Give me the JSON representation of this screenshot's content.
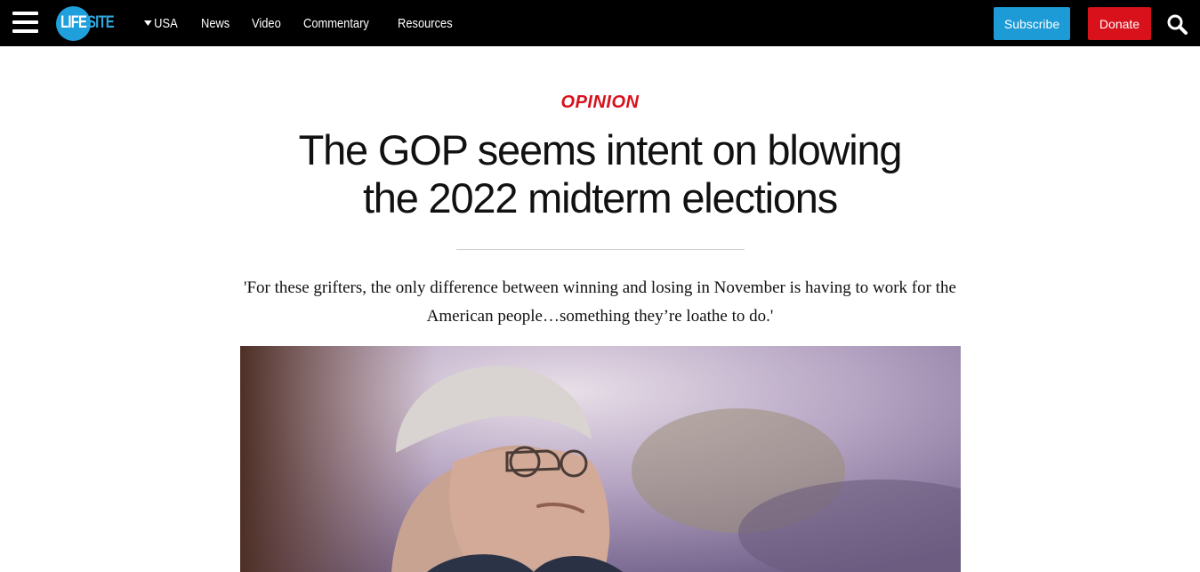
{
  "header": {
    "logo_text_1": "LIFE",
    "logo_text_2": "SITE",
    "menu_icon": "hamburger-menu-icon",
    "nav": [
      {
        "label": "USA",
        "icon": "caret-down-icon"
      },
      {
        "label": "News"
      },
      {
        "label": "Video"
      },
      {
        "label": "Commentary"
      },
      {
        "label": "Resources"
      }
    ],
    "subscribe_label": "Subscribe",
    "donate_label": "Donate",
    "search_icon": "search-icon"
  },
  "article": {
    "kicker": "OPINION",
    "headline": "The GOP seems intent on blowing the 2022 midterm elections",
    "dek": "'For these grifters, the only difference between winning and losing in November is having to work for the American people…something they’re loathe to do.'"
  },
  "colors": {
    "topbar": "#000000",
    "brand_blue": "#1c9bd7",
    "donate_red": "#d8111b",
    "kicker_red": "#d8111b"
  }
}
